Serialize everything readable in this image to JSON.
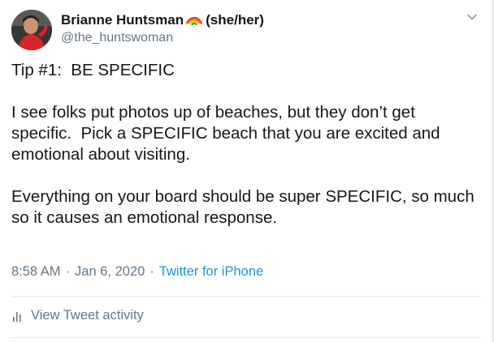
{
  "author": {
    "display_name": "Brianne Huntsman",
    "pronouns": "(she/her)",
    "handle": "@the_huntswoman",
    "emoji_icon": "rainbow-icon"
  },
  "tweet": {
    "text": "Tip #1:  BE SPECIFIC\n\nI see folks put photos up of beaches, but they don’t get specific.  Pick a SPECIFIC beach that you are excited and emotional about visiting.\n\nEverything on your board should be super SPECIFIC, so much so it causes an emotional response.",
    "time": "8:58 AM",
    "date": "Jan 6, 2020",
    "separator": "·",
    "source": "Twitter for iPhone"
  },
  "actions": {
    "view_activity_label": "View Tweet activity"
  },
  "colors": {
    "text": "#14171a",
    "muted": "#657786",
    "link": "#1b95e0",
    "divider": "#e1e8ed"
  }
}
